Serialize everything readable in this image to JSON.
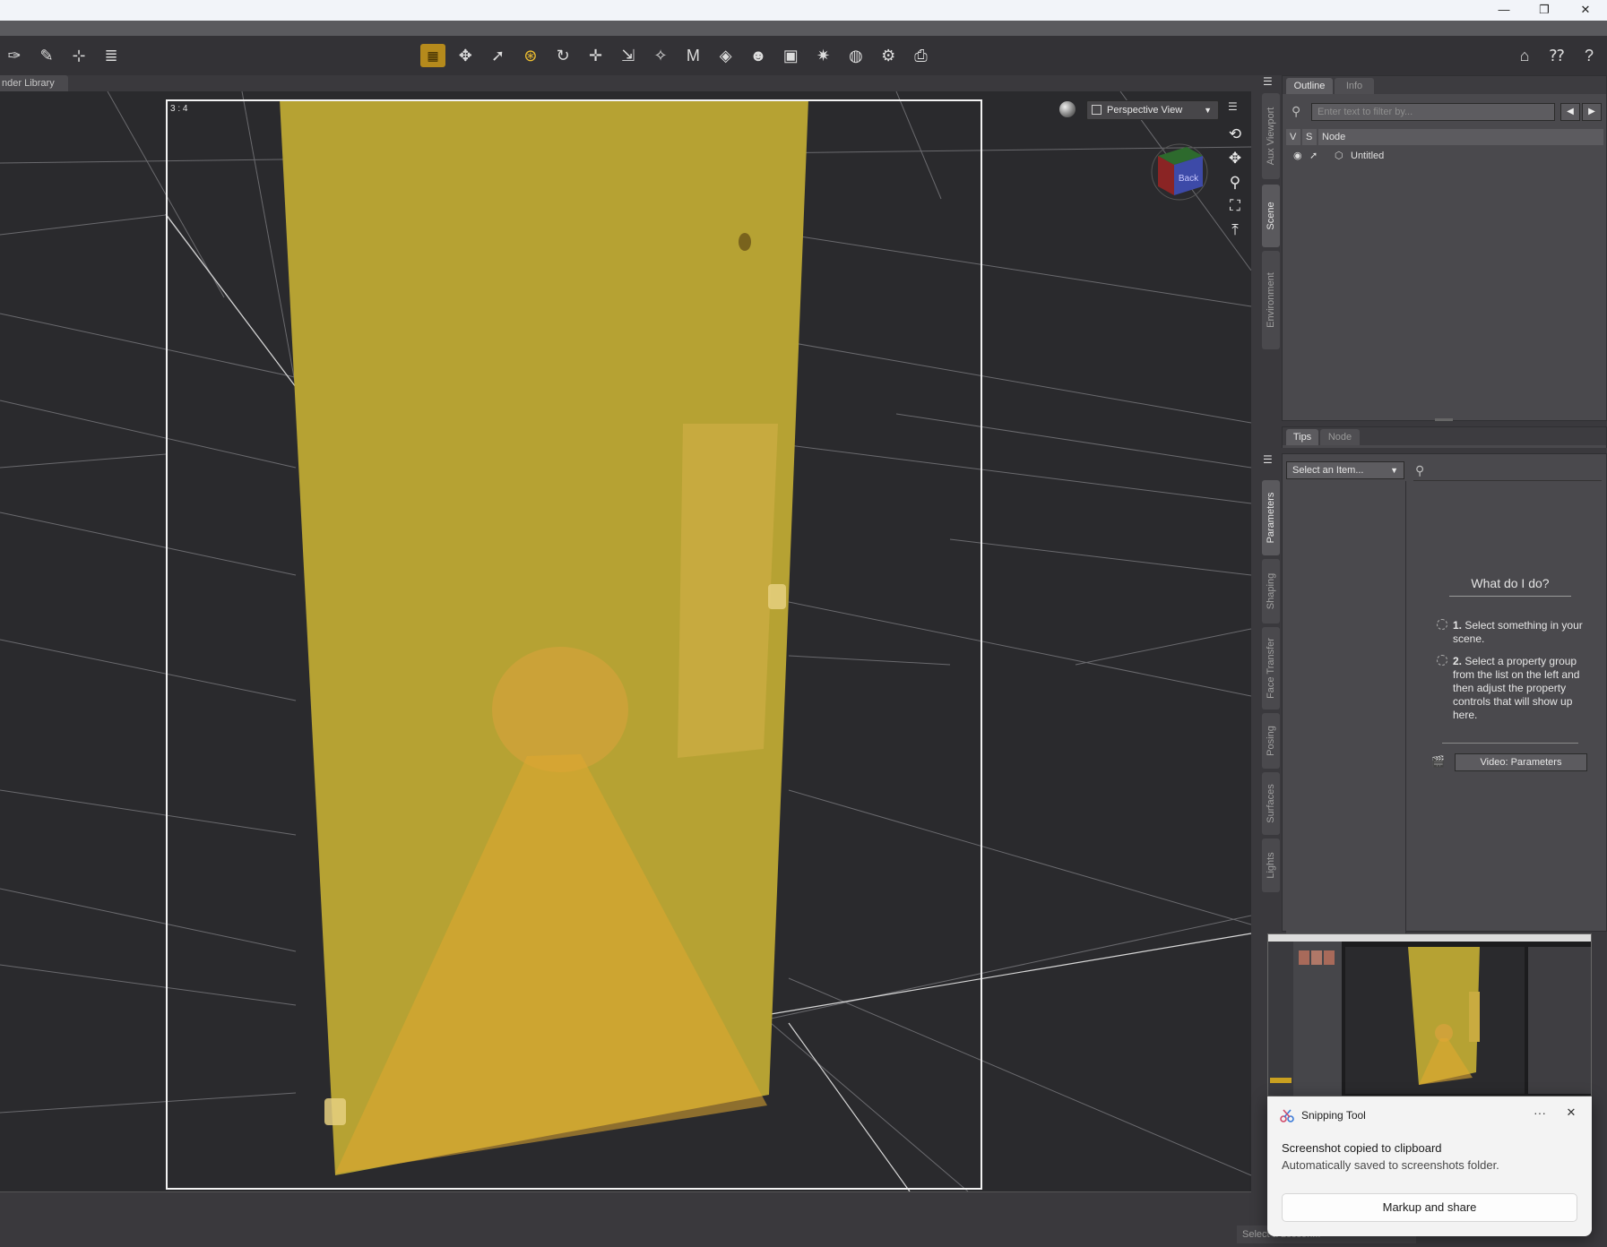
{
  "window": {
    "minimize_glyph": "—",
    "restore_glyph": "❐",
    "close_glyph": "✕"
  },
  "library_tab": {
    "label": "nder Library"
  },
  "toolbar": {
    "left_tools": [
      {
        "name": "transform-pin-icon",
        "glyph": "✑"
      },
      {
        "name": "node-select-icon",
        "glyph": "✎"
      },
      {
        "name": "joint-editor-icon",
        "glyph": "⊹"
      },
      {
        "name": "content-list-icon",
        "glyph": "≣"
      }
    ],
    "center_tools": [
      {
        "name": "smoothing-grid-icon",
        "glyph": "▦",
        "active": true,
        "style": "grid"
      },
      {
        "name": "universal-tool-icon",
        "glyph": "✥"
      },
      {
        "name": "node-selection-icon",
        "glyph": "➚"
      },
      {
        "name": "active-pose-icon",
        "glyph": "⊛",
        "active": true
      },
      {
        "name": "rotate-tool-icon",
        "glyph": "↻"
      },
      {
        "name": "translate-tool-icon",
        "glyph": "✛"
      },
      {
        "name": "scale-tool-icon",
        "glyph": "⇲"
      },
      {
        "name": "surface-selection-icon",
        "glyph": "✧"
      },
      {
        "name": "geometry-editor-icon",
        "glyph": "M"
      },
      {
        "name": "spot-render-icon",
        "glyph": "◈"
      },
      {
        "name": "figure-tool-icon",
        "glyph": "☻"
      },
      {
        "name": "camera-render-icon",
        "glyph": "▣"
      },
      {
        "name": "light-tool-icon",
        "glyph": "✷"
      },
      {
        "name": "sphere-tool-icon",
        "glyph": "◍"
      },
      {
        "name": "render-settings-icon",
        "glyph": "⚙"
      },
      {
        "name": "render-icon",
        "glyph": "⎙"
      }
    ],
    "right_tools": [
      {
        "name": "home-ds-icon",
        "glyph": "⌂"
      },
      {
        "name": "whats-this-icon",
        "glyph": "⁇"
      },
      {
        "name": "help-icon",
        "glyph": "?"
      }
    ]
  },
  "viewport": {
    "aspect_label": "3 : 4",
    "view_name": "Perspective View",
    "navcube_face": "Back",
    "side_tools": [
      {
        "name": "orbit-icon",
        "glyph": "⟲"
      },
      {
        "name": "pan-icon",
        "glyph": "✥"
      },
      {
        "name": "zoom-icon",
        "glyph": "⚲"
      },
      {
        "name": "frame-icon",
        "glyph": "⛶"
      },
      {
        "name": "reset-view-icon",
        "glyph": "⤒"
      }
    ],
    "lesson_placeholder": "Select a Lesson..."
  },
  "side_tabs_top": [
    {
      "label": "Aux Viewport",
      "active": false
    },
    {
      "label": "Scene",
      "active": true
    },
    {
      "label": "Environment",
      "active": false
    }
  ],
  "side_tabs_bottom": [
    {
      "label": "Parameters",
      "active": true
    },
    {
      "label": "Shaping",
      "active": false
    },
    {
      "label": "Face Transfer",
      "active": false
    },
    {
      "label": "Posing",
      "active": false
    },
    {
      "label": "Surfaces",
      "active": false
    },
    {
      "label": "Lights",
      "active": false
    }
  ],
  "scene_panel": {
    "tabs": [
      "Outline",
      "Info"
    ],
    "filter_placeholder": "Enter text to filter by...",
    "columns": [
      "V",
      "S",
      "Node"
    ],
    "nodes": [
      {
        "label": "Untitled"
      }
    ]
  },
  "params_panel": {
    "tabs": [
      "Tips",
      "Node"
    ],
    "select_placeholder": "Select an Item...",
    "help_title": "What do I do?",
    "steps": [
      {
        "num": "1.",
        "text": "Select something in your scene."
      },
      {
        "num": "2.",
        "text": "Select a property group from the list on the left and then adjust the property controls that will show up here."
      }
    ],
    "video_button": "Video: Parameters"
  },
  "snip": {
    "app": "Snipping Tool",
    "more": "···",
    "close": "✕",
    "message": "Screenshot copied to clipboard",
    "sub": "Automatically saved to screenshots folder.",
    "action": "Markup and share"
  },
  "colors": {
    "plane": "#b6a233",
    "light_cone": "#e0a830",
    "grid_line": "#6a6a6e",
    "accent": "#f0c030"
  }
}
